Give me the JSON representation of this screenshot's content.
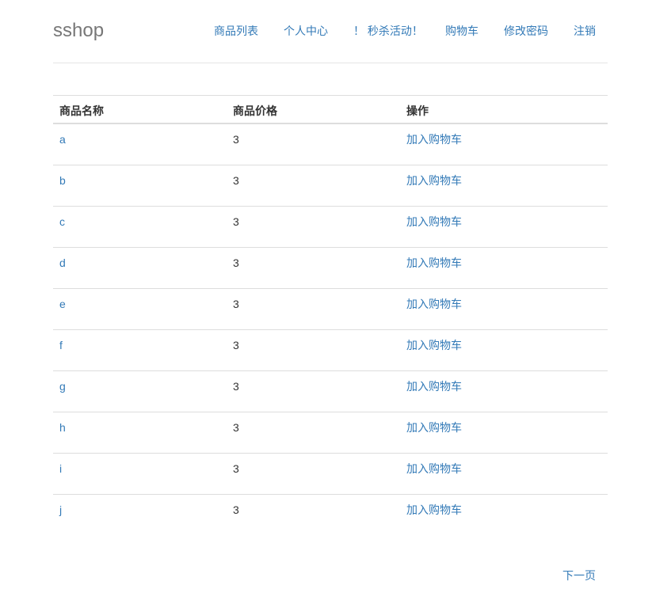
{
  "header": {
    "brand": "sshop",
    "nav": [
      {
        "label": "商品列表"
      },
      {
        "label": "个人中心"
      },
      {
        "label": "！ 秒杀活动！"
      },
      {
        "label": "购物车"
      },
      {
        "label": "修改密码"
      },
      {
        "label": "注销"
      }
    ]
  },
  "table": {
    "columns": [
      "商品名称",
      "商品价格",
      "操作"
    ],
    "rows": [
      {
        "name": "a",
        "price": "3",
        "action": "加入购物车"
      },
      {
        "name": "b",
        "price": "3",
        "action": "加入购物车"
      },
      {
        "name": "c",
        "price": "3",
        "action": "加入购物车"
      },
      {
        "name": "d",
        "price": "3",
        "action": "加入购物车"
      },
      {
        "name": "e",
        "price": "3",
        "action": "加入购物车"
      },
      {
        "name": "f",
        "price": "3",
        "action": "加入购物车"
      },
      {
        "name": "g",
        "price": "3",
        "action": "加入购物车"
      },
      {
        "name": "h",
        "price": "3",
        "action": "加入购物车"
      },
      {
        "name": "i",
        "price": "3",
        "action": "加入购物车"
      },
      {
        "name": "j",
        "price": "3",
        "action": "加入购物车"
      }
    ]
  },
  "pager": {
    "next_label": "下一页"
  },
  "colors": {
    "link": "#337ab7",
    "brand": "#777777",
    "text": "#333333",
    "border": "#dddddd"
  }
}
